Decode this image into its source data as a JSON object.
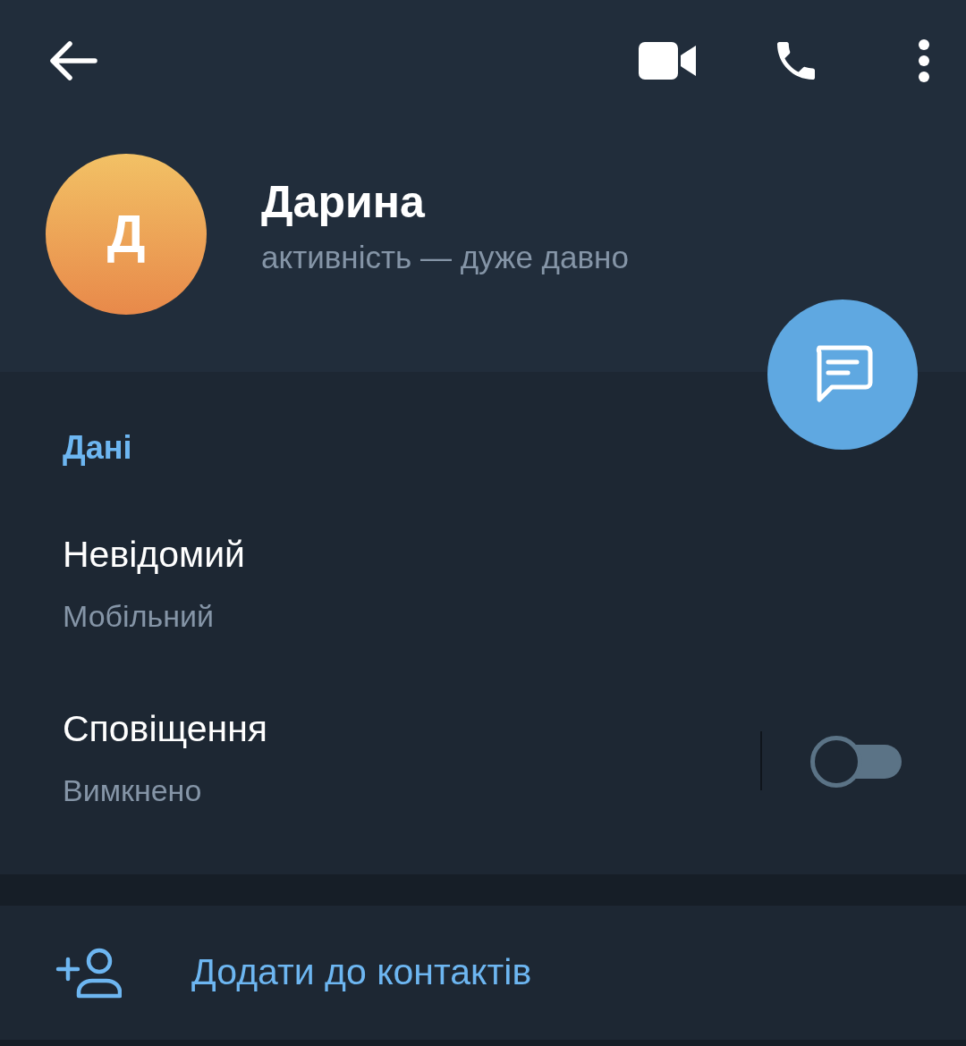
{
  "profile": {
    "initial": "Д",
    "name": "Дарина",
    "status": "активність — дуже давно"
  },
  "info": {
    "title": "Дані",
    "rows": [
      {
        "kind": "info",
        "value": "Невідомий",
        "label": "Мобільний"
      },
      {
        "kind": "toggle",
        "value": "Сповіщення",
        "label": "Вимкнено",
        "on": false
      }
    ]
  },
  "actions": [
    {
      "label": "Додати до контактів"
    }
  ]
}
